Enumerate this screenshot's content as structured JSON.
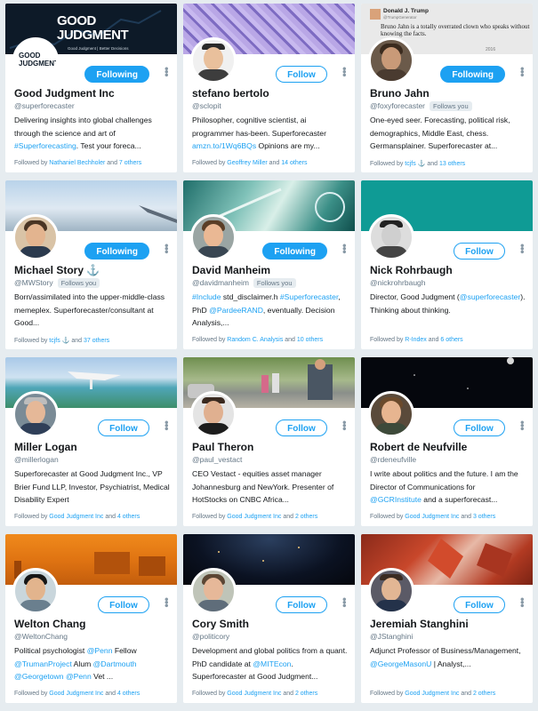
{
  "cards": [
    {
      "name": "Good Judgment Inc",
      "handle": "@superforecaster",
      "button": "Following",
      "button_state": "following",
      "bio": [
        {
          "t": "Delivering insights into global challenges through the science and art of "
        },
        {
          "t": "#Superforecasting",
          "l": true
        },
        {
          "t": ". Test your foreca..."
        }
      ],
      "followed_prefix": "Followed by ",
      "followed_by": "Nathaniel Bechholer",
      "followed_and": " and ",
      "followed_others": "7 others",
      "banner_text": "GOOD JUDGMENT",
      "banner_sub": "Good Judgment | Better Decisions",
      "logo_text": "GOOD JUDGMENT"
    },
    {
      "name": "stefano bertolo",
      "handle": "@sclopit",
      "button": "Follow",
      "button_state": "follow",
      "bio": [
        {
          "t": "Philosopher, cognitive scientist, ai programmer has-been. Superforecaster "
        },
        {
          "t": "amzn.to/1Wq6BQs",
          "l": true
        },
        {
          "t": " Opinions are my..."
        }
      ],
      "followed_prefix": "Followed by ",
      "followed_by": "Geoffrey Miller",
      "followed_and": " and ",
      "followed_others": "14 others"
    },
    {
      "name": "Bruno Jahn",
      "handle": "@foxyforecaster",
      "follows_you": "Follows you",
      "button": "Following",
      "button_state": "following",
      "bio": [
        {
          "t": "One-eyed seer. Forecasting, political risk, demographics, Middle East, chess. Germansplainer. Superforecaster at..."
        }
      ],
      "followed_prefix": "Followed by ",
      "followed_by": "tcjfs ⚓",
      "followed_and": " and ",
      "followed_others": "13 others",
      "banner_tweet_name": "Donald J. Trump",
      "banner_tweet_handle": "@TrumpGenerator",
      "banner_tweet_text": "Bruno Jahn is a totally overrated clown who speaks without knowing the facts.",
      "banner_tweet_year": "2016"
    },
    {
      "name": "Michael Story",
      "name_extra": "⚓",
      "handle": "@MWStory",
      "follows_you": "Follows you",
      "button": "Following",
      "button_state": "following",
      "bio": [
        {
          "t": "Born/assimilated into the upper-middle-class memeplex. Superforecaster/consultant at Good..."
        }
      ],
      "followed_prefix": "Followed by ",
      "followed_by": "tcjfs ⚓",
      "followed_and": " and ",
      "followed_others": "37 others"
    },
    {
      "name": "David Manheim",
      "handle": "@davidmanheim",
      "follows_you": "Follows you",
      "button": "Following",
      "button_state": "following",
      "bio": [
        {
          "t": "#Include",
          "l": true
        },
        {
          "t": " std_disclaimer.h "
        },
        {
          "t": "#Superforecaster",
          "l": true
        },
        {
          "t": ", PhD "
        },
        {
          "t": "@PardeeRAND",
          "l": true
        },
        {
          "t": ", eventually. Decision Analysis,..."
        }
      ],
      "followed_prefix": "Followed by ",
      "followed_by": "Random C. Analysis",
      "followed_and": " and ",
      "followed_others": "10 others"
    },
    {
      "name": "Nick Rohrbaugh",
      "handle": "@nickrohrbaugh",
      "button": "Follow",
      "button_state": "follow",
      "bio": [
        {
          "t": "Director, Good Judgment ("
        },
        {
          "t": "@superforecaster",
          "l": true
        },
        {
          "t": "). Thinking about thinking."
        }
      ],
      "followed_prefix": "Followed by ",
      "followed_by": "R-Index",
      "followed_and": " and ",
      "followed_others": "6 others"
    },
    {
      "name": "Miller Logan",
      "handle": "@millerlogan",
      "button": "Follow",
      "button_state": "follow",
      "bio": [
        {
          "t": "Superforecaster at Good Judgment Inc., VP Brier Fund LLP, Investor, Psychiatrist, Medical Disability Expert"
        }
      ],
      "followed_prefix": "Followed by ",
      "followed_by": "Good Judgment Inc",
      "followed_and": " and ",
      "followed_others": "4 others"
    },
    {
      "name": "Paul Theron",
      "handle": "@paul_vestact",
      "button": "Follow",
      "button_state": "follow",
      "bio": [
        {
          "t": "CEO Vestact - equities asset manager Johannesburg and NewYork. Presenter of HotStocks on CNBC Africa..."
        }
      ],
      "followed_prefix": "Followed by ",
      "followed_by": "Good Judgment Inc",
      "followed_and": " and ",
      "followed_others": "2 others"
    },
    {
      "name": "Robert de Neufville",
      "handle": "@rdeneufville",
      "button": "Follow",
      "button_state": "follow",
      "bio": [
        {
          "t": "I write about politics and the future. I am the Director of Communications for "
        },
        {
          "t": "@GCRInstitute",
          "l": true
        },
        {
          "t": " and a superforecast..."
        }
      ],
      "followed_prefix": "Followed by ",
      "followed_by": "Good Judgment Inc",
      "followed_and": " and ",
      "followed_others": "3 others"
    },
    {
      "name": "Welton Chang",
      "handle": "@WeltonChang",
      "button": "Follow",
      "button_state": "follow",
      "bio": [
        {
          "t": "Political psychologist "
        },
        {
          "t": "@Penn",
          "l": true
        },
        {
          "t": " Fellow "
        },
        {
          "t": "@TrumanProject",
          "l": true
        },
        {
          "t": " Alum "
        },
        {
          "t": "@Dartmouth",
          "l": true
        },
        {
          "t": " "
        },
        {
          "t": "@Georgetown",
          "l": true
        },
        {
          "t": " "
        },
        {
          "t": "@Penn",
          "l": true
        },
        {
          "t": " Vet ..."
        }
      ],
      "followed_prefix": "Followed by ",
      "followed_by": "Good Judgment Inc",
      "followed_and": " and ",
      "followed_others": "4 others"
    },
    {
      "name": "Cory Smith",
      "handle": "@politicory",
      "button": "Follow",
      "button_state": "follow",
      "bio": [
        {
          "t": "Development and global politics from a quant. PhD candidate at "
        },
        {
          "t": "@MITEcon",
          "l": true
        },
        {
          "t": ". Superforecaster at Good Judgment..."
        }
      ],
      "followed_prefix": "Followed by ",
      "followed_by": "Good Judgment Inc",
      "followed_and": " and ",
      "followed_others": "2 others"
    },
    {
      "name": "Jeremiah Stanghini",
      "handle": "@JStanghini",
      "button": "Follow",
      "button_state": "follow",
      "bio": [
        {
          "t": "Adjunct Professor of Business/Management, "
        },
        {
          "t": "@GeorgeMasonU",
          "l": true
        },
        {
          "t": " | Analyst,..."
        }
      ],
      "followed_prefix": "Followed by ",
      "followed_by": "Good Judgment Inc",
      "followed_and": " and ",
      "followed_others": "2 others"
    }
  ],
  "colors": {
    "accent": "#1da1f2",
    "page_bg": "#e6ecf0",
    "muted": "#657786"
  },
  "icons": {
    "more": "more-vertical-icon"
  }
}
